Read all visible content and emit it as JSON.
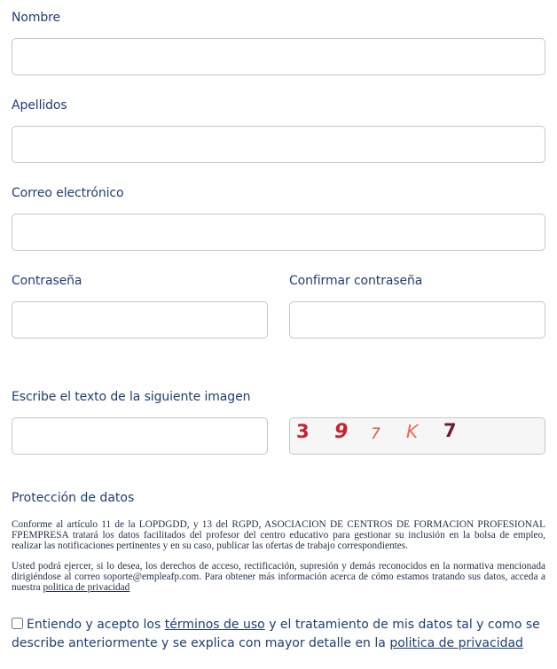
{
  "form": {
    "nombre_label": "Nombre",
    "apellidos_label": "Apellidos",
    "email_label": "Correo electrónico",
    "password_label": "Contraseña",
    "confirm_password_label": "Confirmar contraseña",
    "captcha_label": "Escribe el texto de la siguiente imagen",
    "captcha_text": "397K7"
  },
  "privacy": {
    "title": "Protección de datos",
    "paragraph1": "Conforme al artículo 11 de la LOPDGDD, y 13 del RGPD, ASOCIACION DE CENTROS DE FORMACION PROFESIONAL FPEMPRESA tratará los datos facilitados del profesor del centro educativo para gestionar su inclusión en la bolsa de empleo, realizar las notificaciones pertinentes y en su caso, publicar las ofertas de trabajo correspondientes.",
    "paragraph2": "Usted podrá ejercer, si lo desea, los derechos de acceso, rectificación, supresión y demás reconocidos en la normativa mencionada dirigiéndose al correo soporte@empleafp.com. Para obtener más información acerca de cómo estamos tratando sus datos, acceda a nuestra",
    "policy_link": "politica de privacidad"
  },
  "consent": {
    "text_before": "Entiendo y acepto los",
    "terms_link": "términos de uso",
    "text_middle": "y el tratamiento de mis datos tal y como se describe anteriormente y se explica con mayor detalle en la",
    "policy_link": "politica de privacidad"
  },
  "colors": {
    "label": "#1d3f73",
    "border": "#c2c6cc"
  }
}
